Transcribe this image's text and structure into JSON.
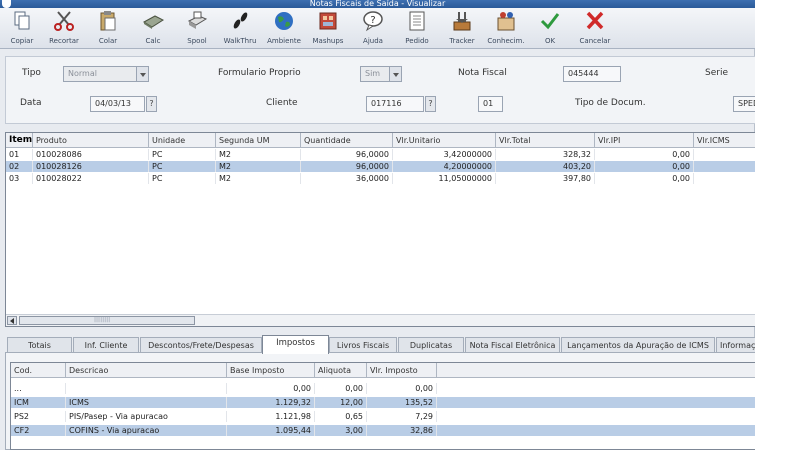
{
  "window": {
    "title": "Notas Fiscais de Saída - Visualizar"
  },
  "toolbar": [
    {
      "key": "copiar",
      "label": "Copiar",
      "icon": "copy-icon"
    },
    {
      "key": "recortar",
      "label": "Recortar",
      "icon": "scissors-icon"
    },
    {
      "key": "colar",
      "label": "Colar",
      "icon": "paste-icon"
    },
    {
      "key": "calc",
      "label": "Calc",
      "icon": "calculator-icon"
    },
    {
      "key": "spool",
      "label": "Spool",
      "icon": "printer-icon"
    },
    {
      "key": "walkthru",
      "label": "WalkThru",
      "icon": "footprints-icon"
    },
    {
      "key": "ambiente",
      "label": "Ambiente",
      "icon": "globe-icon"
    },
    {
      "key": "mashups",
      "label": "Mashups",
      "icon": "mashup-icon"
    },
    {
      "key": "ajuda",
      "label": "Ajuda",
      "icon": "help-icon"
    },
    {
      "key": "pedido",
      "label": "Pedido",
      "icon": "document-icon"
    },
    {
      "key": "tracker",
      "label": "Tracker",
      "icon": "tracker-icon"
    },
    {
      "key": "conhecim",
      "label": "Conhecim.",
      "icon": "knowledge-icon"
    },
    {
      "key": "ok",
      "label": "OK",
      "icon": "check-icon"
    },
    {
      "key": "cancelar",
      "label": "Cancelar",
      "icon": "x-icon"
    }
  ],
  "header": {
    "tipo_label": "Tipo",
    "tipo_value": "Normal",
    "formulario_label": "Formulario Proprio",
    "formulario_value": "Sim",
    "nota_label": "Nota Fiscal",
    "nota_value": "045444",
    "serie_label": "Serie",
    "data_label": "Data",
    "data_value": "04/03/13",
    "cliente_label": "Cliente",
    "cliente_value": "017116",
    "loja_value": "01",
    "tipodoc_label": "Tipo de Docum.",
    "tipodoc_value": "SPED",
    "help_glyph": "?"
  },
  "items_grid": {
    "columns": [
      "Item",
      "Produto",
      "Unidade",
      "Segunda UM",
      "Quantidade",
      "Vlr.Unitario",
      "Vlr.Total",
      "Vlr.IPI",
      "Vlr.ICMS"
    ],
    "rows": [
      [
        "01",
        "010028086",
        "PC",
        "M2",
        "96,0000",
        "3,42000000",
        "328,32",
        "0,00",
        ""
      ],
      [
        "02",
        "010028126",
        "PC",
        "M2",
        "96,0000",
        "4,20000000",
        "403,20",
        "0,00",
        ""
      ],
      [
        "03",
        "010028022",
        "PC",
        "M2",
        "36,0000",
        "11,05000000",
        "397,80",
        "0,00",
        ""
      ]
    ],
    "selected_row": 1
  },
  "tabs": [
    {
      "label": "Totais"
    },
    {
      "label": "Inf. Cliente"
    },
    {
      "label": "Descontos/Frete/Despesas"
    },
    {
      "label": "Impostos",
      "active": true
    },
    {
      "label": "Livros Fiscais"
    },
    {
      "label": "Duplicatas"
    },
    {
      "label": "Nota Fiscal Eletrônica"
    },
    {
      "label": "Lançamentos da Apuração de ICMS"
    },
    {
      "label": "Informaç"
    }
  ],
  "taxes_grid": {
    "columns": [
      "Cod.",
      "Descricao",
      "Base Imposto",
      "Aliquota",
      "Vlr. Imposto"
    ],
    "rows": [
      [
        "...",
        "",
        "0,00",
        "0,00",
        "0,00"
      ],
      [
        "ICM",
        "ICMS",
        "1.129,32",
        "12,00",
        "135,52"
      ],
      [
        "PS2",
        "PIS/Pasep - Via apuracao",
        "1.121,98",
        "0,65",
        "7,29"
      ],
      [
        "CF2",
        "COFINS - Via apuracao",
        "1.095,44",
        "3,00",
        "32,86"
      ]
    ],
    "selected_rows": [
      1,
      3
    ]
  }
}
